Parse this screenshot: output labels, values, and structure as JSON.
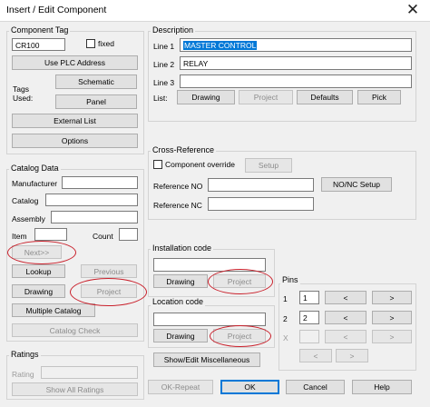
{
  "window": {
    "title": "Insert / Edit Component",
    "close_glyph": "✕"
  },
  "component_tag": {
    "group": "Component Tag",
    "value": "CR100",
    "fixed_label": "fixed",
    "use_plc": "Use PLC Address",
    "tags_used_1": "Tags",
    "tags_used_2": "Used:",
    "schematic": "Schematic",
    "panel": "Panel",
    "external_list": "External List",
    "options": "Options"
  },
  "catalog": {
    "group": "Catalog Data",
    "manufacturer": "Manufacturer",
    "catalog": "Catalog",
    "assembly": "Assembly",
    "item": "Item",
    "count": "Count",
    "next": "Next>>",
    "lookup": "Lookup",
    "previous": "Previous",
    "drawing": "Drawing",
    "project": "Project",
    "multiple": "Multiple Catalog",
    "check": "Catalog Check"
  },
  "ratings": {
    "group": "Ratings",
    "rating": "Rating",
    "show_all": "Show All Ratings"
  },
  "description": {
    "group": "Description",
    "line1_label": "Line 1",
    "line1": "MASTER CONTROL",
    "line2_label": "Line 2",
    "line2": "RELAY",
    "line3_label": "Line 3",
    "line3": "",
    "list_label": "List:",
    "drawing": "Drawing",
    "project": "Project",
    "defaults": "Defaults",
    "pick": "Pick"
  },
  "cross_ref": {
    "group": "Cross-Reference",
    "override": "Component override",
    "setup": "Setup",
    "ref_no": "Reference NO",
    "ref_nc": "Reference NC",
    "nonc": "NO/NC Setup"
  },
  "install": {
    "group": "Installation code",
    "drawing": "Drawing",
    "project": "Project"
  },
  "location": {
    "group": "Location code",
    "drawing": "Drawing",
    "project": "Project"
  },
  "pins": {
    "group": "Pins",
    "row1": "1",
    "pin1": "1",
    "row2": "2",
    "pin2": "2",
    "row3": "X",
    "left": "<",
    "right": ">"
  },
  "footer": {
    "show_edit": "Show/Edit Miscellaneous",
    "ok_repeat": "OK-Repeat",
    "ok": "OK",
    "cancel": "Cancel",
    "help": "Help"
  }
}
